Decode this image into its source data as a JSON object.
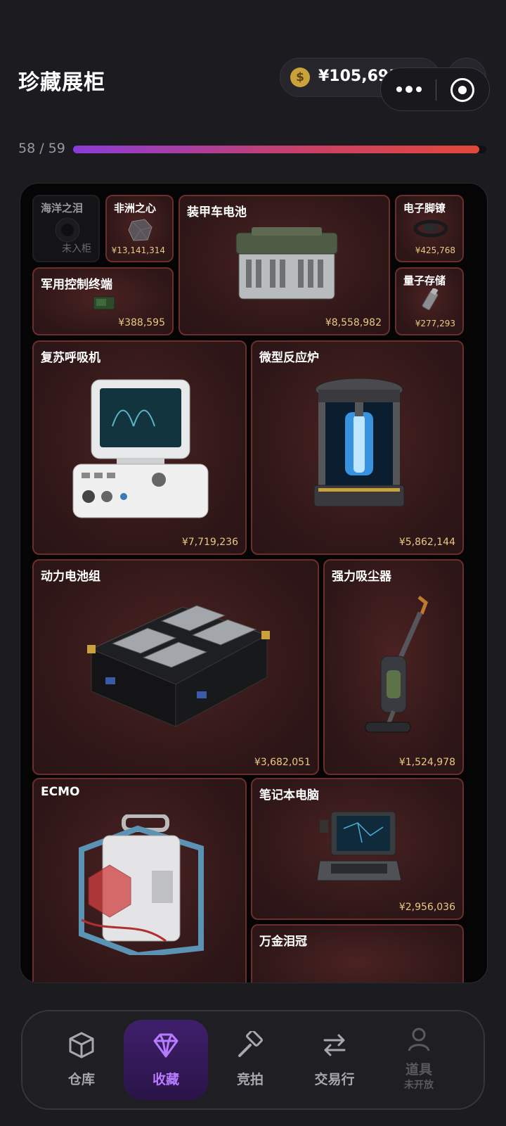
{
  "header": {
    "title": "珍藏展柜"
  },
  "balance": {
    "text": "¥105,695,574",
    "coin_symbol": "$"
  },
  "plus_label": "+",
  "progress": {
    "label": "58 / 59",
    "fraction": 0.983
  },
  "cabinet": {
    "items": [
      {
        "name": "海洋之泪",
        "status": "未入柜"
      },
      {
        "name": "非洲之心",
        "price": "¥13,141,314"
      },
      {
        "name": "装甲车电池",
        "price": "¥8,558,982"
      },
      {
        "name": "电子脚镣",
        "price": "¥425,768"
      },
      {
        "name": "军用控制终端",
        "price": "¥388,595"
      },
      {
        "name": "量子存储",
        "price": "¥277,293"
      },
      {
        "name": "复苏呼吸机",
        "price": "¥7,719,236"
      },
      {
        "name": "微型反应炉",
        "price": "¥5,862,144"
      },
      {
        "name": "动力电池组",
        "price": "¥3,682,051"
      },
      {
        "name": "强力吸尘器",
        "price": "¥1,524,978"
      },
      {
        "name": "ECMO"
      },
      {
        "name": "笔记本电脑",
        "price": "¥2,956,036"
      },
      {
        "name": "万金泪冠"
      }
    ]
  },
  "nav": {
    "items": [
      {
        "label": "仓库",
        "icon": "box-icon"
      },
      {
        "label": "收藏",
        "icon": "diamond-icon",
        "active": true
      },
      {
        "label": "竞拍",
        "icon": "gavel-icon"
      },
      {
        "label": "交易行",
        "icon": "swap-icon"
      },
      {
        "label": "道具",
        "sublabel": "未开放",
        "icon": "user-icon"
      }
    ]
  },
  "colors": {
    "accent": "#b77bff",
    "price": "#e9c982",
    "card_border": "#6b2e2b"
  }
}
